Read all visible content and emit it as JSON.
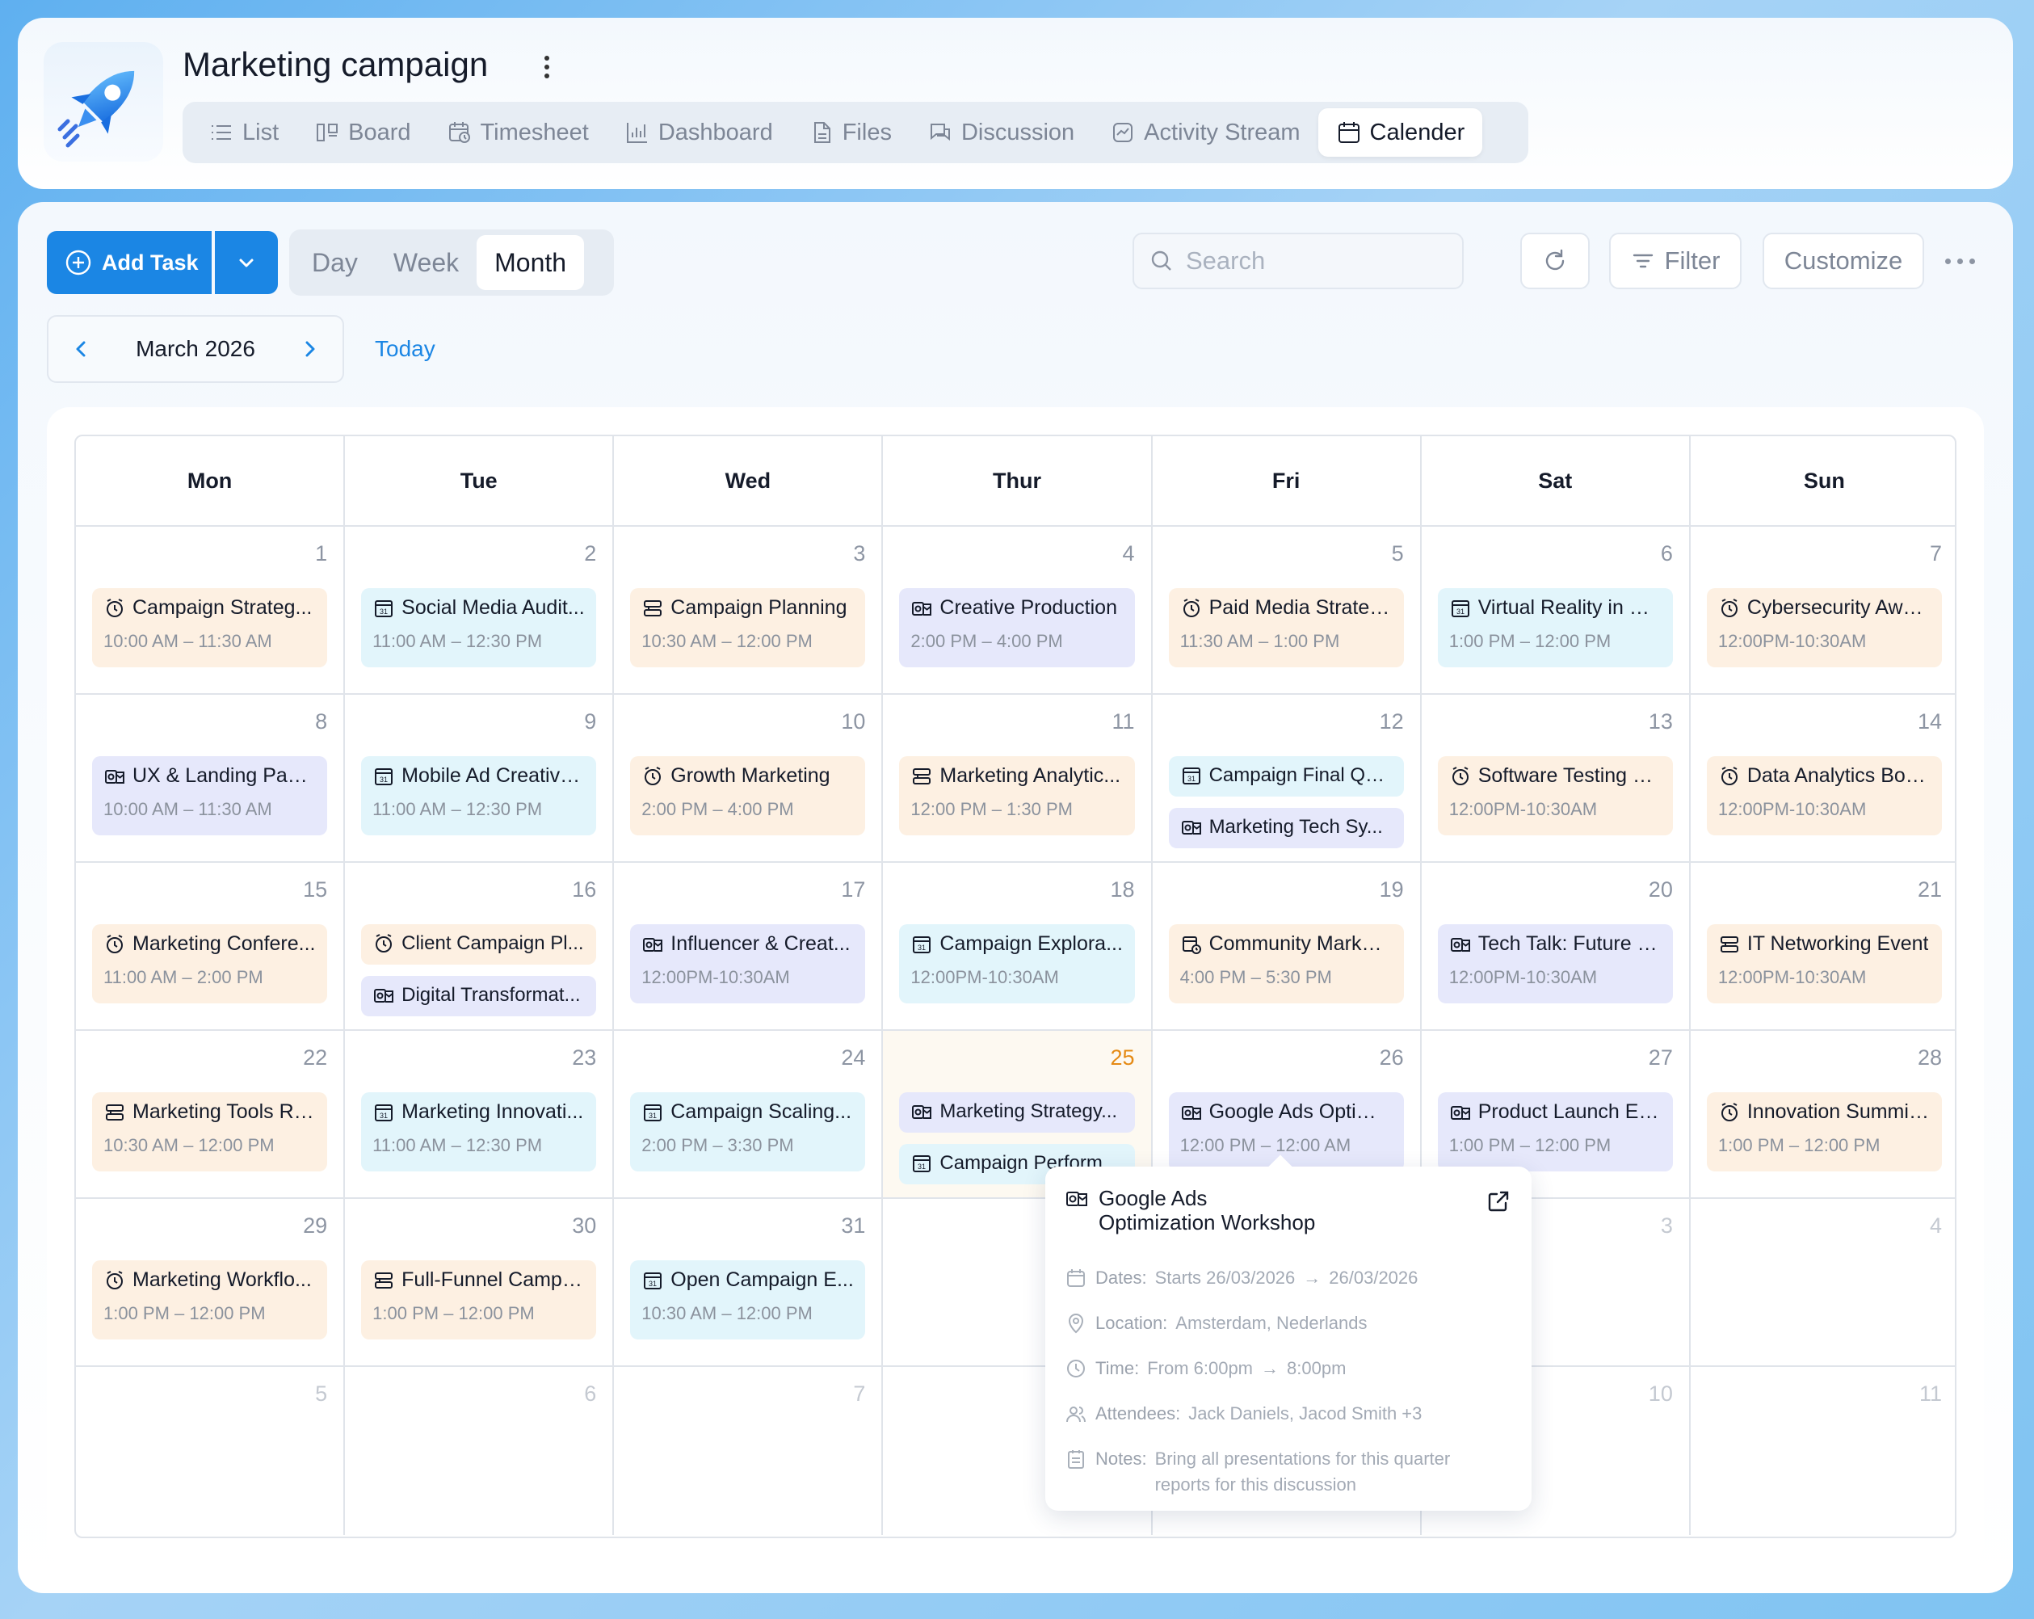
{
  "project": {
    "title": "Marketing campaign"
  },
  "tabs": [
    {
      "label": "List",
      "icon": "list-icon"
    },
    {
      "label": "Board",
      "icon": "board-icon"
    },
    {
      "label": "Timesheet",
      "icon": "timesheet-icon"
    },
    {
      "label": "Dashboard",
      "icon": "dashboard-icon"
    },
    {
      "label": "Files",
      "icon": "file-icon"
    },
    {
      "label": "Discussion",
      "icon": "discussion-icon"
    },
    {
      "label": "Activity Stream",
      "icon": "activity-icon"
    },
    {
      "label": "Calender",
      "icon": "calendar-icon",
      "active": true
    }
  ],
  "toolbar": {
    "add_task": "Add Task",
    "views": [
      "Day",
      "Week",
      "Month"
    ],
    "active_view": "Month",
    "search_placeholder": "Search",
    "filter": "Filter",
    "customize": "Customize"
  },
  "nav": {
    "month": "March 2026",
    "today": "Today"
  },
  "colors": {
    "accent": "#1b86e4",
    "event_orange": "#fdf0e2",
    "event_cyan": "#e2f5fb",
    "event_indigo": "#e6e8fb",
    "current_day": "#e58a14"
  },
  "weekdays": [
    "Mon",
    "Tue",
    "Wed",
    "Thur",
    "Fri",
    "Sat",
    "Sun"
  ],
  "weeks": [
    [
      {
        "day": "1",
        "events": [
          {
            "title": "Campaign Strateg...",
            "time": "10:00 AM – 11:30 AM",
            "color": "orange",
            "icon": "alarm"
          }
        ]
      },
      {
        "day": "2",
        "events": [
          {
            "title": "Social Media Audit...",
            "time": "11:00 AM – 12:30 PM",
            "color": "cyan",
            "icon": "cal31"
          }
        ]
      },
      {
        "day": "3",
        "events": [
          {
            "title": "Campaign Planning",
            "time": "10:30 AM – 12:00 PM",
            "color": "orange",
            "icon": "server"
          }
        ]
      },
      {
        "day": "4",
        "events": [
          {
            "title": "Creative Production",
            "time": "2:00 PM – 4:00 PM",
            "color": "indigo",
            "icon": "outlook"
          }
        ]
      },
      {
        "day": "5",
        "events": [
          {
            "title": "Paid Media Strateg...",
            "time": "11:30 AM – 1:00 PM",
            "color": "orange",
            "icon": "alarm"
          }
        ]
      },
      {
        "day": "6",
        "events": [
          {
            "title": "Virtual Reality in Bu...",
            "time": "1:00 PM – 12:00 PM",
            "color": "cyan",
            "icon": "cal31"
          }
        ]
      },
      {
        "day": "7",
        "events": [
          {
            "title": "Cybersecurity Awa...",
            "time": "12:00PM-10:30AM",
            "color": "orange",
            "icon": "alarm"
          }
        ]
      }
    ],
    [
      {
        "day": "8",
        "events": [
          {
            "title": "UX & Landing Page...",
            "time": "10:00 AM – 11:30 AM",
            "color": "indigo",
            "icon": "outlook"
          }
        ]
      },
      {
        "day": "9",
        "events": [
          {
            "title": "Mobile Ad Creative...",
            "time": "11:00 AM – 12:30 PM",
            "color": "cyan",
            "icon": "cal31"
          }
        ]
      },
      {
        "day": "10",
        "events": [
          {
            "title": "Growth Marketing",
            "time": "2:00 PM – 4:00 PM",
            "color": "orange",
            "icon": "alarm"
          }
        ]
      },
      {
        "day": "11",
        "events": [
          {
            "title": "Marketing Analytic...",
            "time": "12:00 PM – 1:30 PM",
            "color": "orange",
            "icon": "server"
          }
        ]
      },
      {
        "day": "12",
        "events": [
          {
            "title": "Campaign Final QA...",
            "color": "cyan",
            "icon": "cal31"
          },
          {
            "title": "Marketing Tech Sy...",
            "color": "indigo",
            "icon": "outlook"
          }
        ]
      },
      {
        "day": "13",
        "events": [
          {
            "title": "Software Testing S...",
            "time": "12:00PM-10:30AM",
            "color": "orange",
            "icon": "alarm"
          }
        ]
      },
      {
        "day": "14",
        "events": [
          {
            "title": "Data Analytics Boo...",
            "time": "12:00PM-10:30AM",
            "color": "orange",
            "icon": "alarm"
          }
        ]
      }
    ],
    [
      {
        "day": "15",
        "events": [
          {
            "title": "Marketing Confere...",
            "time": "11:00 AM – 2:00 PM",
            "color": "orange",
            "icon": "alarm"
          }
        ]
      },
      {
        "day": "16",
        "events": [
          {
            "title": "Client Campaign Pl...",
            "color": "orange",
            "icon": "alarm"
          },
          {
            "title": "Digital Transformat...",
            "color": "indigo",
            "icon": "outlook"
          }
        ]
      },
      {
        "day": "17",
        "events": [
          {
            "title": "Influencer & Creat...",
            "time": "12:00PM-10:30AM",
            "color": "indigo",
            "icon": "outlook"
          }
        ]
      },
      {
        "day": "18",
        "events": [
          {
            "title": "Campaign Explora...",
            "time": "12:00PM-10:30AM",
            "color": "cyan",
            "icon": "cal31"
          }
        ]
      },
      {
        "day": "19",
        "events": [
          {
            "title": "Community Market...",
            "time": "4:00 PM – 5:30 PM",
            "color": "orange",
            "icon": "calclock"
          }
        ]
      },
      {
        "day": "20",
        "events": [
          {
            "title": "Tech Talk: Future of...",
            "time": "12:00PM-10:30AM",
            "color": "indigo",
            "icon": "outlook"
          }
        ]
      },
      {
        "day": "21",
        "events": [
          {
            "title": "IT Networking Event",
            "time": "12:00PM-10:30AM",
            "color": "orange",
            "icon": "server"
          }
        ]
      }
    ],
    [
      {
        "day": "22",
        "events": [
          {
            "title": "Marketing Tools Re...",
            "time": "10:30 AM – 12:00 PM",
            "color": "orange",
            "icon": "server"
          }
        ]
      },
      {
        "day": "23",
        "events": [
          {
            "title": "Marketing Innovati...",
            "time": "11:00 AM – 12:30 PM",
            "color": "cyan",
            "icon": "cal31"
          }
        ]
      },
      {
        "day": "24",
        "events": [
          {
            "title": "Campaign Scaling...",
            "time": "2:00 PM – 3:30 PM",
            "color": "cyan",
            "icon": "cal31"
          }
        ]
      },
      {
        "day": "25",
        "current": true,
        "events": [
          {
            "title": "Marketing Strategy...",
            "color": "indigo",
            "icon": "outlook"
          },
          {
            "title": "Campaign Perform...",
            "color": "cyan",
            "icon": "cal31"
          }
        ]
      },
      {
        "day": "26",
        "events": [
          {
            "title": "Google Ads Optimi...",
            "time": "12:00 PM – 12:00 AM",
            "color": "indigo",
            "icon": "outlook"
          }
        ]
      },
      {
        "day": "27",
        "events": [
          {
            "title": "Product Launch Ev...",
            "time": "1:00 PM – 12:00 PM",
            "color": "indigo",
            "icon": "outlook"
          }
        ]
      },
      {
        "day": "28",
        "events": [
          {
            "title": "Innovation Summit...",
            "time": "1:00 PM – 12:00 PM",
            "color": "orange",
            "icon": "alarm"
          }
        ]
      }
    ],
    [
      {
        "day": "29",
        "events": [
          {
            "title": "Marketing Workflo...",
            "time": "1:00 PM – 12:00 PM",
            "color": "orange",
            "icon": "alarm"
          }
        ]
      },
      {
        "day": "30",
        "events": [
          {
            "title": "Full-Funnel Campa...",
            "time": "1:00 PM – 12:00 PM",
            "color": "orange",
            "icon": "server"
          }
        ]
      },
      {
        "day": "31",
        "events": [
          {
            "title": "Open Campaign E...",
            "time": "10:30 AM – 12:00 PM",
            "color": "cyan",
            "icon": "cal31"
          }
        ]
      },
      {
        "day": "1",
        "muted": true,
        "events": []
      },
      {
        "day": "2",
        "muted": true,
        "events": []
      },
      {
        "day": "3",
        "muted": true,
        "events": []
      },
      {
        "day": "4",
        "muted": true,
        "events": []
      }
    ],
    [
      {
        "day": "5",
        "muted": true,
        "events": []
      },
      {
        "day": "6",
        "muted": true,
        "events": []
      },
      {
        "day": "7",
        "muted": true,
        "events": []
      },
      {
        "day": "8",
        "muted": true,
        "events": []
      },
      {
        "day": "9",
        "muted": true,
        "events": []
      },
      {
        "day": "10",
        "muted": true,
        "events": []
      },
      {
        "day": "11",
        "muted": true,
        "events": []
      }
    ]
  ],
  "popover": {
    "title_line1": "Google Ads",
    "title_line2": "Optimization Workshop",
    "dates_label": "Dates:",
    "dates_start": "Starts 26/03/2026",
    "dates_end": "26/03/2026",
    "location_label": "Location:",
    "location": "Amsterdam, Nederlands",
    "time_label": "Time:",
    "time_start": "From 6:00pm",
    "time_end": "8:00pm",
    "attendees_label": "Attendees:",
    "attendees": "Jack Daniels, Jacod Smith +3",
    "notes_label": "Notes:",
    "notes": "Bring all presentations for this quarter reports for this discussion"
  }
}
